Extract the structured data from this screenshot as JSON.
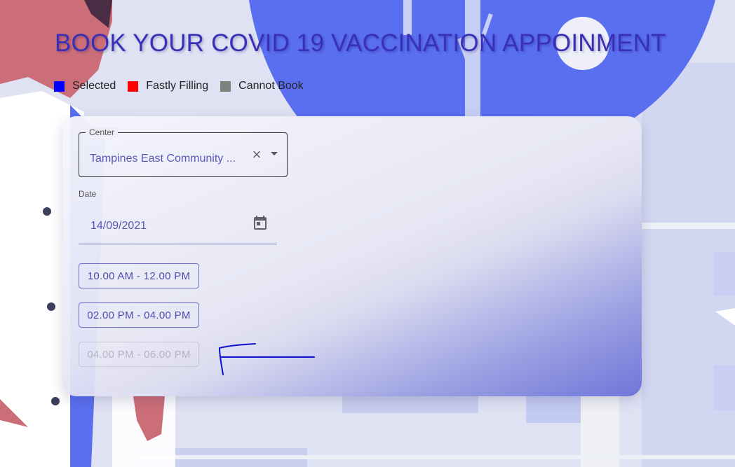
{
  "page": {
    "title": "BOOK YOUR COVID 19 VACCINATION APPOINMENT"
  },
  "legend": [
    {
      "label": "Selected",
      "color": "#0000ff"
    },
    {
      "label": "Fastly Filling",
      "color": "#ff0000"
    },
    {
      "label": "Cannot Book",
      "color": "#808080"
    }
  ],
  "form": {
    "center": {
      "label": "Center",
      "value": "Tampines East Community ...",
      "clear_icon": "close-icon",
      "dropdown_icon": "arrow-drop-down-icon"
    },
    "date": {
      "label": "Date",
      "value": "14/09/2021",
      "icon": "calendar-icon"
    },
    "time_slots": [
      {
        "label": "10.00 AM - 12.00 PM",
        "disabled": false
      },
      {
        "label": "02.00 PM - 04.00 PM",
        "disabled": false
      },
      {
        "label": "04.00 PM - 06.00 PM",
        "disabled": true
      }
    ]
  },
  "colors": {
    "title": "#3a2fb8",
    "accent": "#5b57b8",
    "annotation": "#0a12d0",
    "background_blue": "#5a6ff0"
  }
}
